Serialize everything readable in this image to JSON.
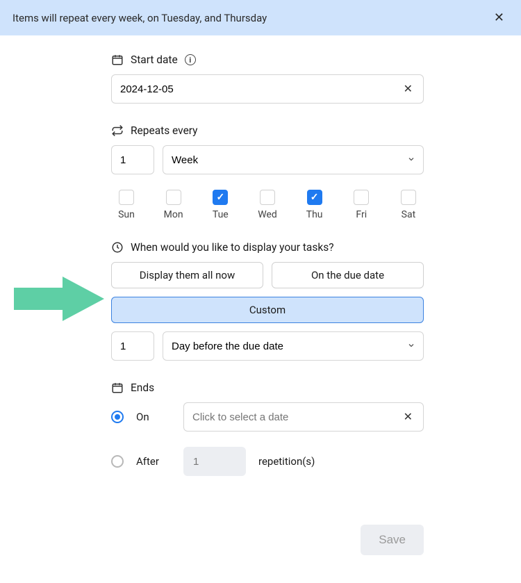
{
  "banner": {
    "text": "Items will repeat every week, on Tuesday, and Thursday"
  },
  "start_date": {
    "label": "Start date",
    "value": "2024-12-05"
  },
  "repeats": {
    "label": "Repeats every",
    "interval": "1",
    "unit": "Week",
    "days": [
      {
        "abbr": "Sun",
        "checked": false
      },
      {
        "abbr": "Mon",
        "checked": false
      },
      {
        "abbr": "Tue",
        "checked": true
      },
      {
        "abbr": "Wed",
        "checked": false
      },
      {
        "abbr": "Thu",
        "checked": true
      },
      {
        "abbr": "Fri",
        "checked": false
      },
      {
        "abbr": "Sat",
        "checked": false
      }
    ]
  },
  "display": {
    "label": "When would you like to display your tasks?",
    "opt_all_now": "Display them all now",
    "opt_due_date": "On the due date",
    "opt_custom": "Custom",
    "custom_count": "1",
    "custom_unit": "Day before the due date"
  },
  "ends": {
    "label": "Ends",
    "opt_on": "On",
    "opt_after": "After",
    "date_placeholder": "Click to select a date",
    "rep_count": "1",
    "rep_suffix": "repetition(s)"
  },
  "footer": {
    "save": "Save"
  },
  "colors": {
    "accent_blue": "#1f7af0",
    "banner_bg": "#cfe3fc",
    "arrow": "#5ecfa5"
  }
}
